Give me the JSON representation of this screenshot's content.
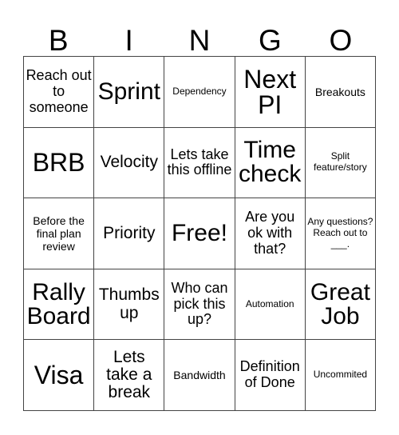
{
  "card": {
    "title_letters": [
      "B",
      "I",
      "N",
      "G",
      "O"
    ],
    "colors": {
      "background": "#ffffff",
      "border": "#444444",
      "text": "#000000"
    },
    "columns": 5,
    "rows": 5,
    "free_space_label": "Free!",
    "cells": [
      {
        "text": "Reach out to someone",
        "size": "sm"
      },
      {
        "text": "Sprint",
        "size": "lg"
      },
      {
        "text": "Dependency",
        "size": "xxs"
      },
      {
        "text": "Next PI",
        "size": "xl"
      },
      {
        "text": "Breakouts",
        "size": "xs"
      },
      {
        "text": "BRB",
        "size": "xl"
      },
      {
        "text": "Velocity",
        "size": "md"
      },
      {
        "text": "Lets take this offline",
        "size": "sm"
      },
      {
        "text": "Time check",
        "size": "lg"
      },
      {
        "text": "Split feature/story",
        "size": "xxs"
      },
      {
        "text": "Before the final plan review",
        "size": "xs"
      },
      {
        "text": "Priority",
        "size": "md"
      },
      {
        "text": "Free!",
        "size": "lg"
      },
      {
        "text": "Are you ok with that?",
        "size": "sm"
      },
      {
        "text": "Any questions? Reach out to ___.",
        "size": "xxs"
      },
      {
        "text": "Rally Board",
        "size": "lg"
      },
      {
        "text": "Thumbs up",
        "size": "md"
      },
      {
        "text": "Who can pick this up?",
        "size": "sm"
      },
      {
        "text": "Automation",
        "size": "xxs"
      },
      {
        "text": "Great Job",
        "size": "lg"
      },
      {
        "text": "Visa",
        "size": "xl"
      },
      {
        "text": "Lets take a break",
        "size": "md"
      },
      {
        "text": "Bandwidth",
        "size": "xs"
      },
      {
        "text": "Definition of Done",
        "size": "sm"
      },
      {
        "text": "Uncommited",
        "size": "xxs"
      }
    ]
  }
}
